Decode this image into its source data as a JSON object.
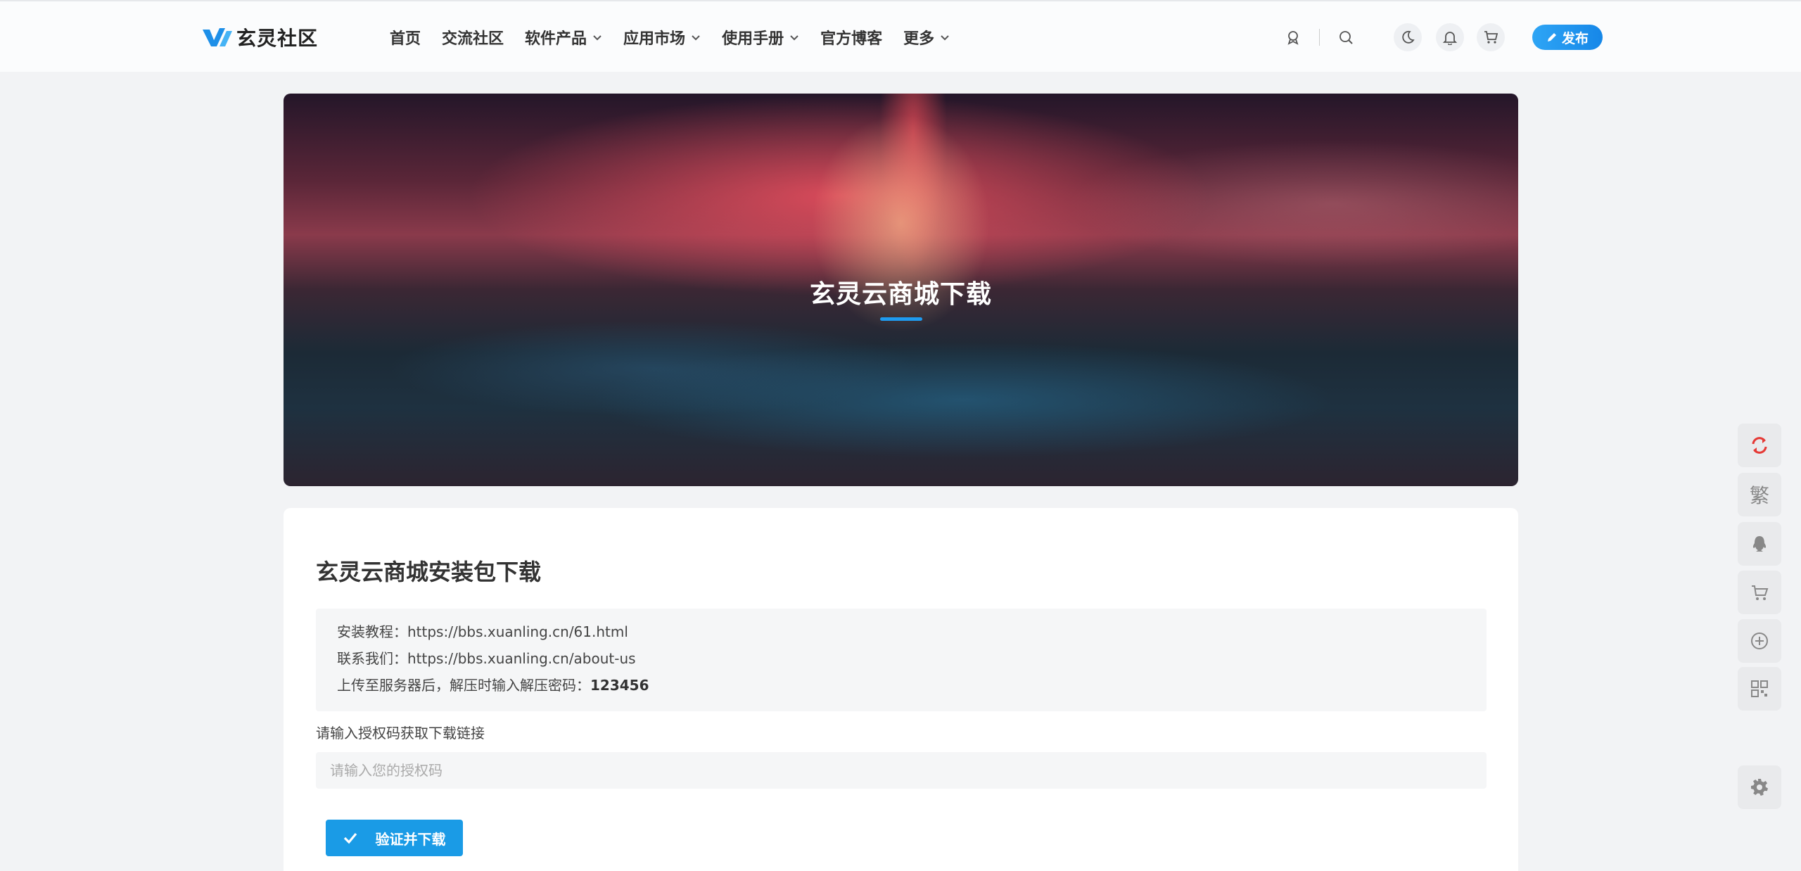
{
  "header": {
    "logo_text": "玄灵社区",
    "nav": [
      {
        "label": "首页"
      },
      {
        "label": "交流社区"
      },
      {
        "label": "软件产品"
      },
      {
        "label": "应用市场"
      },
      {
        "label": "使用手册"
      },
      {
        "label": "官方博客"
      },
      {
        "label": "更多"
      }
    ],
    "publish_label": "发布"
  },
  "banner": {
    "title": "玄灵云商城下载"
  },
  "content": {
    "title": "玄灵云商城安装包下载",
    "info": {
      "tutorial_label": "安装教程：",
      "tutorial_url": "https://bbs.xuanling.cn/61.html",
      "contact_label": "联系我们：",
      "contact_url": "https://bbs.xuanling.cn/about-us",
      "password_text": "上传至服务器后，解压时输入解压密码：",
      "password_value": "123456"
    },
    "auth_label": "请输入授权码获取下载链接",
    "auth_placeholder": "请输入您的授权码",
    "verify_label": "验证并下载"
  },
  "sidebar": {
    "traditional_glyph": "繁"
  },
  "colors": {
    "accent": "#1a9be6",
    "refresh": "#e53935"
  }
}
